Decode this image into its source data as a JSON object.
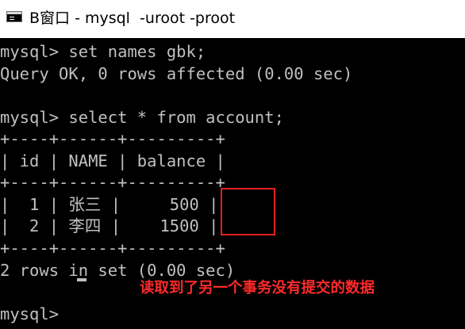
{
  "window": {
    "title": "B窗口 - mysql  -uroot -proot"
  },
  "console": {
    "lines": [
      "mysql> set names gbk;",
      "Query OK, 0 rows affected (0.00 sec)",
      "",
      "mysql> select * from account;",
      "+----+------+---------+",
      "| id | NAME | balance |",
      "+----+------+---------+",
      "|  1 | 张三 |     500 |",
      "|  2 | 李四 |    1500 |",
      "+----+------+---------+",
      "2 rows in set (0.00 sec)",
      "",
      "mysql> "
    ]
  },
  "annotation": {
    "text": "读取到了另一个事务没有提交的数据",
    "color": "#ff2a2a"
  },
  "colors": {
    "console_bg": "#000000",
    "console_fg": "#c0c0c0",
    "highlight_border": "#e02020"
  },
  "icons": {
    "window_icon": "console-window-icon"
  }
}
